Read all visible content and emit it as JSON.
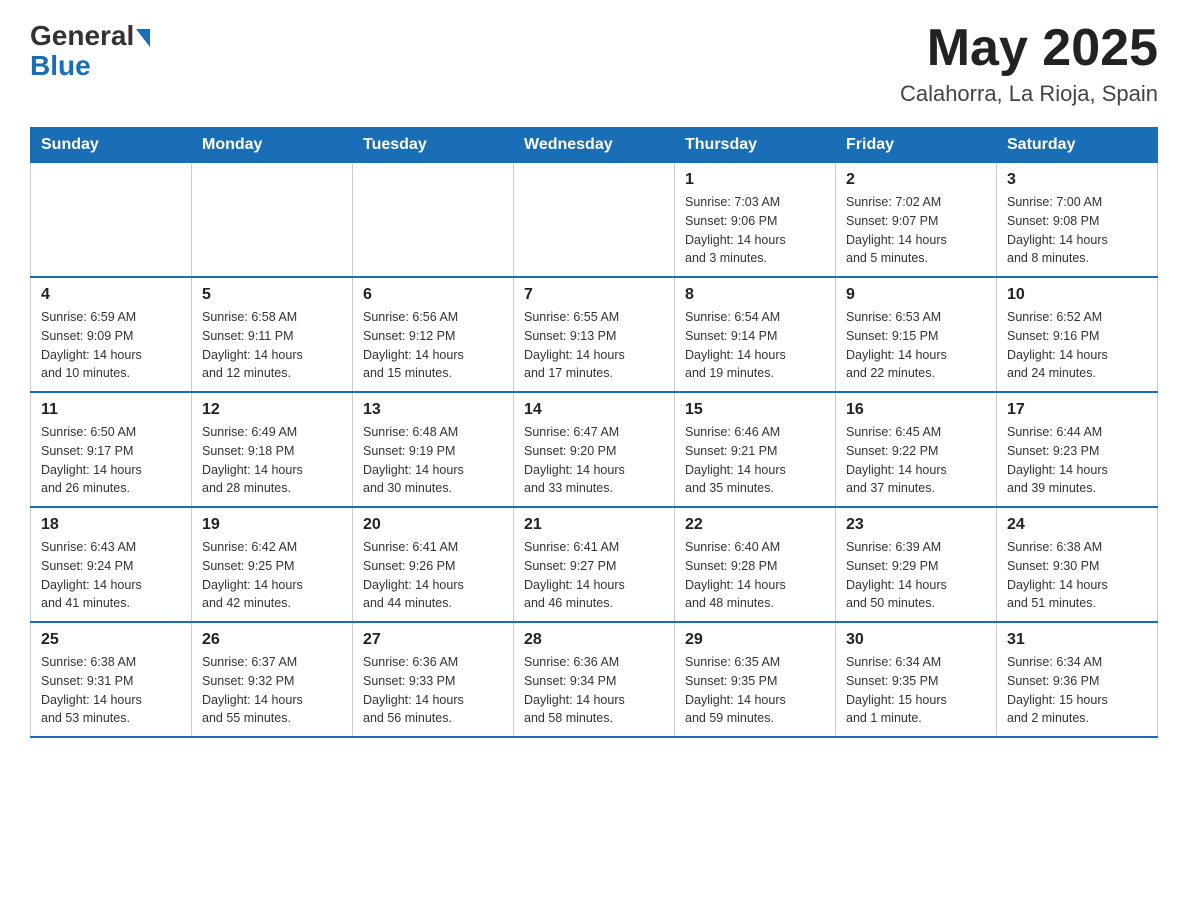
{
  "header": {
    "logo_text_general": "General",
    "logo_text_blue": "Blue",
    "month_title": "May 2025",
    "location": "Calahorra, La Rioja, Spain"
  },
  "weekdays": [
    "Sunday",
    "Monday",
    "Tuesday",
    "Wednesday",
    "Thursday",
    "Friday",
    "Saturday"
  ],
  "weeks": [
    [
      {
        "day": "",
        "info": ""
      },
      {
        "day": "",
        "info": ""
      },
      {
        "day": "",
        "info": ""
      },
      {
        "day": "",
        "info": ""
      },
      {
        "day": "1",
        "info": "Sunrise: 7:03 AM\nSunset: 9:06 PM\nDaylight: 14 hours\nand 3 minutes."
      },
      {
        "day": "2",
        "info": "Sunrise: 7:02 AM\nSunset: 9:07 PM\nDaylight: 14 hours\nand 5 minutes."
      },
      {
        "day": "3",
        "info": "Sunrise: 7:00 AM\nSunset: 9:08 PM\nDaylight: 14 hours\nand 8 minutes."
      }
    ],
    [
      {
        "day": "4",
        "info": "Sunrise: 6:59 AM\nSunset: 9:09 PM\nDaylight: 14 hours\nand 10 minutes."
      },
      {
        "day": "5",
        "info": "Sunrise: 6:58 AM\nSunset: 9:11 PM\nDaylight: 14 hours\nand 12 minutes."
      },
      {
        "day": "6",
        "info": "Sunrise: 6:56 AM\nSunset: 9:12 PM\nDaylight: 14 hours\nand 15 minutes."
      },
      {
        "day": "7",
        "info": "Sunrise: 6:55 AM\nSunset: 9:13 PM\nDaylight: 14 hours\nand 17 minutes."
      },
      {
        "day": "8",
        "info": "Sunrise: 6:54 AM\nSunset: 9:14 PM\nDaylight: 14 hours\nand 19 minutes."
      },
      {
        "day": "9",
        "info": "Sunrise: 6:53 AM\nSunset: 9:15 PM\nDaylight: 14 hours\nand 22 minutes."
      },
      {
        "day": "10",
        "info": "Sunrise: 6:52 AM\nSunset: 9:16 PM\nDaylight: 14 hours\nand 24 minutes."
      }
    ],
    [
      {
        "day": "11",
        "info": "Sunrise: 6:50 AM\nSunset: 9:17 PM\nDaylight: 14 hours\nand 26 minutes."
      },
      {
        "day": "12",
        "info": "Sunrise: 6:49 AM\nSunset: 9:18 PM\nDaylight: 14 hours\nand 28 minutes."
      },
      {
        "day": "13",
        "info": "Sunrise: 6:48 AM\nSunset: 9:19 PM\nDaylight: 14 hours\nand 30 minutes."
      },
      {
        "day": "14",
        "info": "Sunrise: 6:47 AM\nSunset: 9:20 PM\nDaylight: 14 hours\nand 33 minutes."
      },
      {
        "day": "15",
        "info": "Sunrise: 6:46 AM\nSunset: 9:21 PM\nDaylight: 14 hours\nand 35 minutes."
      },
      {
        "day": "16",
        "info": "Sunrise: 6:45 AM\nSunset: 9:22 PM\nDaylight: 14 hours\nand 37 minutes."
      },
      {
        "day": "17",
        "info": "Sunrise: 6:44 AM\nSunset: 9:23 PM\nDaylight: 14 hours\nand 39 minutes."
      }
    ],
    [
      {
        "day": "18",
        "info": "Sunrise: 6:43 AM\nSunset: 9:24 PM\nDaylight: 14 hours\nand 41 minutes."
      },
      {
        "day": "19",
        "info": "Sunrise: 6:42 AM\nSunset: 9:25 PM\nDaylight: 14 hours\nand 42 minutes."
      },
      {
        "day": "20",
        "info": "Sunrise: 6:41 AM\nSunset: 9:26 PM\nDaylight: 14 hours\nand 44 minutes."
      },
      {
        "day": "21",
        "info": "Sunrise: 6:41 AM\nSunset: 9:27 PM\nDaylight: 14 hours\nand 46 minutes."
      },
      {
        "day": "22",
        "info": "Sunrise: 6:40 AM\nSunset: 9:28 PM\nDaylight: 14 hours\nand 48 minutes."
      },
      {
        "day": "23",
        "info": "Sunrise: 6:39 AM\nSunset: 9:29 PM\nDaylight: 14 hours\nand 50 minutes."
      },
      {
        "day": "24",
        "info": "Sunrise: 6:38 AM\nSunset: 9:30 PM\nDaylight: 14 hours\nand 51 minutes."
      }
    ],
    [
      {
        "day": "25",
        "info": "Sunrise: 6:38 AM\nSunset: 9:31 PM\nDaylight: 14 hours\nand 53 minutes."
      },
      {
        "day": "26",
        "info": "Sunrise: 6:37 AM\nSunset: 9:32 PM\nDaylight: 14 hours\nand 55 minutes."
      },
      {
        "day": "27",
        "info": "Sunrise: 6:36 AM\nSunset: 9:33 PM\nDaylight: 14 hours\nand 56 minutes."
      },
      {
        "day": "28",
        "info": "Sunrise: 6:36 AM\nSunset: 9:34 PM\nDaylight: 14 hours\nand 58 minutes."
      },
      {
        "day": "29",
        "info": "Sunrise: 6:35 AM\nSunset: 9:35 PM\nDaylight: 14 hours\nand 59 minutes."
      },
      {
        "day": "30",
        "info": "Sunrise: 6:34 AM\nSunset: 9:35 PM\nDaylight: 15 hours\nand 1 minute."
      },
      {
        "day": "31",
        "info": "Sunrise: 6:34 AM\nSunset: 9:36 PM\nDaylight: 15 hours\nand 2 minutes."
      }
    ]
  ]
}
